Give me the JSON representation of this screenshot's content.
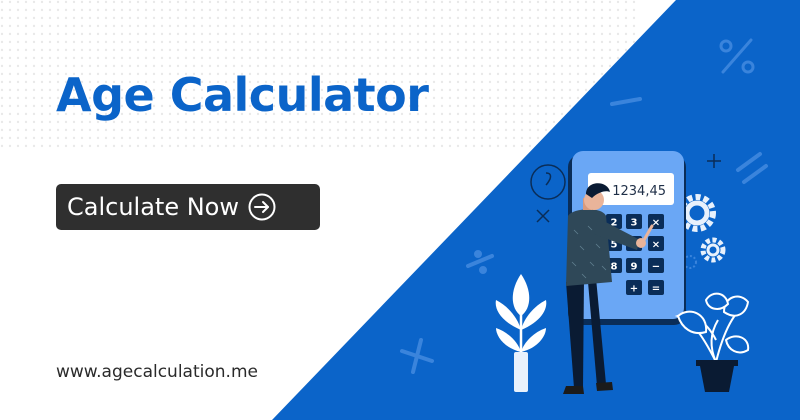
{
  "banner": {
    "title": "Age Calculator",
    "cta_label": "Calculate Now",
    "url": "www.agecalculation.me"
  },
  "calculator": {
    "display_value": "1234,45",
    "keys": [
      "2",
      "3",
      "×",
      "5",
      "6",
      "×",
      "8",
      "9",
      "−",
      "+",
      "="
    ]
  },
  "colors": {
    "brand_blue": "#0b64c9",
    "button_dark": "#2f2f2f",
    "calculator_light_blue": "#6aa7f5"
  },
  "icons": {
    "cta": "arrow-right-circle-icon",
    "decor": [
      "percent-icon",
      "gear-icon",
      "plus-icon",
      "times-icon",
      "divide-icon",
      "minus-icon",
      "plant-icon",
      "potted-plant-icon"
    ]
  }
}
